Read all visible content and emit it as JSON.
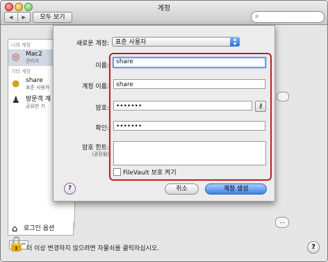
{
  "window": {
    "title": "계정"
  },
  "toolbar": {
    "back": "◀",
    "forward": "▶",
    "show_all": "모두 보기",
    "search_placeholder": ""
  },
  "sidebar": {
    "my_account_header": "나의 계정",
    "my_account": {
      "name": "Mac2",
      "role": "관리자"
    },
    "other_accounts_header": "기타 계정",
    "others": [
      {
        "name": "share",
        "role": "표준 사용자"
      },
      {
        "name": "방문객 계",
        "role": "공유만 가"
      }
    ],
    "login_options": "로그인 옵션",
    "add": "+",
    "remove": "−"
  },
  "footer": {
    "lock_text": "더 이상 변경하지 않으려면 자물쇠를 클릭하십시오.",
    "help": "?"
  },
  "sheet": {
    "new_account_label": "새로운 계정:",
    "new_account_value": "표준 사용자",
    "name_label": "이름:",
    "name_value": "share",
    "account_name_label": "계정 이름:",
    "account_name_value": "share",
    "password_label": "암호:",
    "password_value": "•••••••",
    "verify_label": "확인:",
    "verify_value": "•••••••",
    "hint_label": "암호 힌트:",
    "hint_sub": "(권장됨)",
    "hint_value": "",
    "filevault_label": "FileVault 보호 켜기",
    "help": "?",
    "cancel": "취소",
    "create": "계정 생성"
  },
  "colors": {
    "highlight": "#d01616",
    "primary_button": "#3c83e3"
  }
}
